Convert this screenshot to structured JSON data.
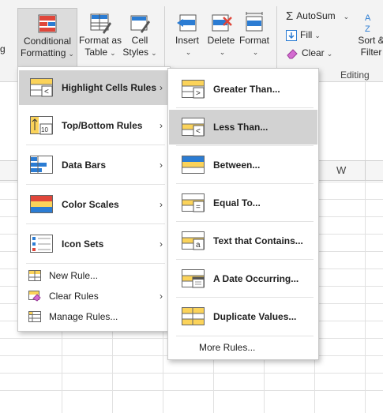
{
  "ribbon": {
    "conditional_formatting": {
      "line1": "Conditional",
      "line2": "Formatting"
    },
    "format_as_table": {
      "line1": "Format as",
      "line2": "Table"
    },
    "cell_styles": {
      "line1": "Cell",
      "line2": "Styles"
    },
    "insert": {
      "label": "Insert"
    },
    "delete": {
      "label": "Delete"
    },
    "format": {
      "label": "Format"
    },
    "autosum": {
      "label": "AutoSum"
    },
    "fill": {
      "label": "Fill"
    },
    "clear": {
      "label": "Clear"
    },
    "sort_filter": {
      "line1": "Sort &",
      "line2": "Filter"
    },
    "group_editing": "Editing"
  },
  "grid": {
    "column_w": "W"
  },
  "cf_menu": {
    "items": [
      {
        "label": "Highlight Cells Rules",
        "icon": "highlight-cells-icon",
        "submenu": true
      },
      {
        "label": "Top/Bottom Rules",
        "icon": "top-bottom-icon",
        "submenu": true
      },
      {
        "label": "Data Bars",
        "icon": "data-bars-icon",
        "submenu": true
      },
      {
        "label": "Color Scales",
        "icon": "color-scales-icon",
        "submenu": true
      },
      {
        "label": "Icon Sets",
        "icon": "icon-sets-icon",
        "submenu": true
      },
      {
        "label": "New Rule...",
        "icon": "new-rule-icon",
        "submenu": false
      },
      {
        "label": "Clear Rules",
        "icon": "clear-rules-icon",
        "submenu": true
      },
      {
        "label": "Manage Rules...",
        "icon": "manage-rules-icon",
        "submenu": false
      }
    ]
  },
  "highlight_submenu": {
    "items": [
      {
        "label": "Greater Than...",
        "icon": "greater-than-icon"
      },
      {
        "label": "Less Than...",
        "icon": "less-than-icon"
      },
      {
        "label": "Between...",
        "icon": "between-icon"
      },
      {
        "label": "Equal To...",
        "icon": "equal-to-icon"
      },
      {
        "label": "Text that Contains...",
        "icon": "text-contains-icon"
      },
      {
        "label": "A Date Occurring...",
        "icon": "date-occurring-icon"
      },
      {
        "label": "Duplicate Values...",
        "icon": "duplicate-values-icon"
      },
      {
        "label": "More Rules...",
        "icon": "more-rules-icon"
      }
    ]
  },
  "colors": {
    "accent_blue": "#2b7cd3",
    "highlight_yellow": "#fbd35a",
    "red": "#e0463a",
    "selected_bg": "#d2d2d2"
  }
}
